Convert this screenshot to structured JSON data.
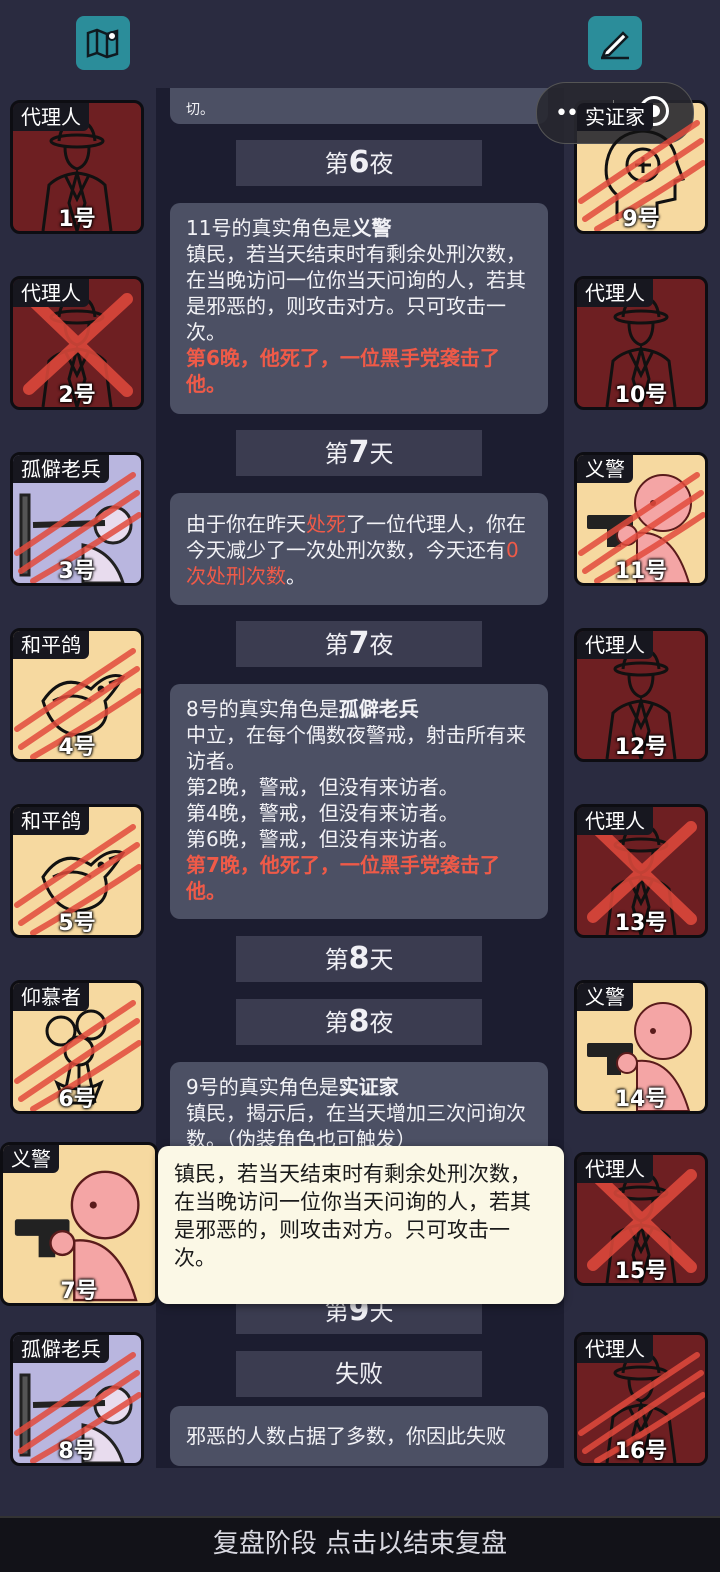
{
  "capsule": {
    "dots": "•••"
  },
  "left_cards": [
    {
      "role": "代理人",
      "num": "1号",
      "art": "agent",
      "slash": "none"
    },
    {
      "role": "代理人",
      "num": "2号",
      "art": "agent",
      "slash": "cross"
    },
    {
      "role": "孤僻老兵",
      "num": "3号",
      "art": "veteran",
      "slash": "claw"
    },
    {
      "role": "和平鸽",
      "num": "4号",
      "art": "dove",
      "slash": "claw"
    },
    {
      "role": "和平鸽",
      "num": "5号",
      "art": "dove",
      "slash": "claw"
    },
    {
      "role": "仰慕者",
      "num": "6号",
      "art": "flower",
      "slash": "claw"
    },
    {
      "role": "义警",
      "num": "7号",
      "art": "vigilante",
      "slash": "none"
    },
    {
      "role": "孤僻老兵",
      "num": "8号",
      "art": "veteran",
      "slash": "claw"
    }
  ],
  "right_cards": [
    {
      "role": "实证家",
      "num": "9号",
      "art": "head",
      "slash": "claw"
    },
    {
      "role": "代理人",
      "num": "10号",
      "art": "agent",
      "slash": "none"
    },
    {
      "role": "义警",
      "num": "11号",
      "art": "vigilante",
      "slash": "claw"
    },
    {
      "role": "代理人",
      "num": "12号",
      "art": "agent",
      "slash": "none"
    },
    {
      "role": "代理人",
      "num": "13号",
      "art": "agent",
      "slash": "cross"
    },
    {
      "role": "义警",
      "num": "14号",
      "art": "vigilante",
      "slash": "none"
    },
    {
      "role": "代理人",
      "num": "15号",
      "art": "agent",
      "slash": "cross"
    },
    {
      "role": "代理人",
      "num": "16号",
      "art": "agent",
      "slash": "claw"
    }
  ],
  "log": {
    "top_fragment": "切。",
    "night6_prefix": "第",
    "night6_num": "6",
    "night6_suffix": "夜",
    "e1_head": "11号的真实角色是",
    "e1_role": "义警",
    "e1_body": "镇民，若当天结束时有剩余处刑次数，在当晚访问一位你当天问询的人，若其是邪恶的，则攻击对方。只可攻击一次。",
    "e1_death": "第6晚，他死了，一位黑手党袭击了他。",
    "day7_prefix": "第",
    "day7_num": "7",
    "day7_suffix": "天",
    "e2_a": "由于你在昨天",
    "e2_b": "处死",
    "e2_c": "了一位代理人，你在今天减少了一次处刑次数，今天还有",
    "e2_d": "0次处刑次数",
    "e2_e": "。",
    "night7_prefix": "第",
    "night7_num": "7",
    "night7_suffix": "夜",
    "e3_head": "8号的真实角色是",
    "e3_role": "孤僻老兵",
    "e3_body": "中立，在每个偶数夜警戒，射击所有来访者。",
    "e3_l1": "第2晚，警戒，但没有来访者。",
    "e3_l2": "第4晚，警戒，但没有来访者。",
    "e3_l3": "第6晚，警戒，但没有来访者。",
    "e3_death": "第7晚，他死了，一位黑手党袭击了他。",
    "day8_prefix": "第",
    "day8_num": "8",
    "day8_suffix": "天",
    "night8_prefix": "第",
    "night8_num": "8",
    "night8_suffix": "夜",
    "e4_head": "9号的真实角色是",
    "e4_role": "实证家",
    "e4_body": "镇民，揭示后，在当天增加三次问询次数。（伪装角色也可触发）",
    "day9_prefix": "第",
    "day9_num": "9",
    "day9_suffix": "天",
    "fail_label": "失败",
    "e5": "邪恶的人数占据了多数，你因此失败"
  },
  "tooltip": "镇民，若当天结束时有剩余处刑次数，在当晚访问一位你当天问询的人，若其是邪恶的，则攻击对方。只可攻击一次。",
  "footer": "复盘阶段 点击以结束复盘"
}
